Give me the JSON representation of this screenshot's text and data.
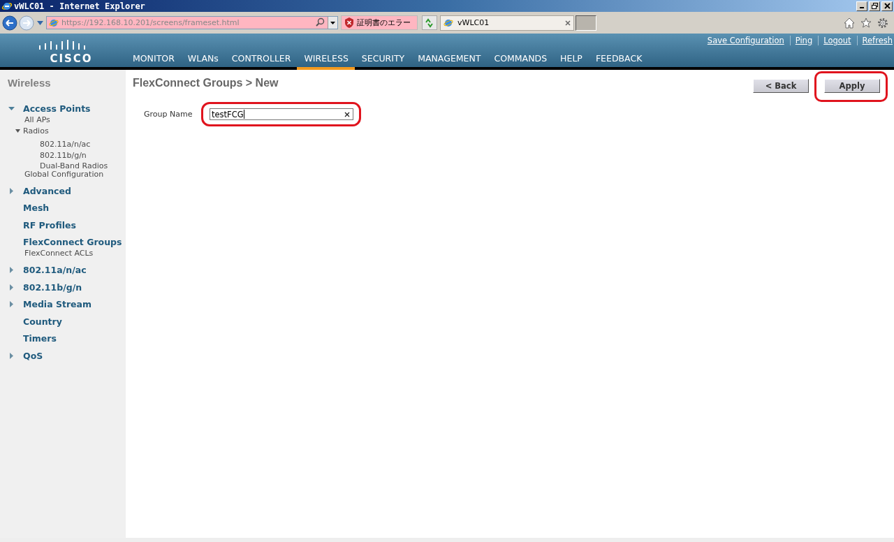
{
  "window": {
    "title": "vWLC01 - Internet Explorer"
  },
  "browser": {
    "url": "https://192.168.10.201/screens/frameset.html",
    "cert_error": "証明書のエラー",
    "tabs": [
      {
        "label": "vWLC01",
        "selected": true
      }
    ]
  },
  "header": {
    "logo": "CISCO",
    "top_links": [
      "Save Configuration",
      "Ping",
      "Logout",
      "Refresh"
    ],
    "menu": [
      {
        "label": "MONITOR",
        "selected": false
      },
      {
        "label": "WLANs",
        "selected": false
      },
      {
        "label": "CONTROLLER",
        "selected": false
      },
      {
        "label": "WIRELESS",
        "selected": true
      },
      {
        "label": "SECURITY",
        "selected": false
      },
      {
        "label": "MANAGEMENT",
        "selected": false
      },
      {
        "label": "COMMANDS",
        "selected": false
      },
      {
        "label": "HELP",
        "selected": false
      },
      {
        "label": "FEEDBACK",
        "selected": false
      }
    ]
  },
  "sidebar": {
    "title": "Wireless",
    "items": [
      {
        "label": "Access Points",
        "kind": "expandable",
        "expanded": true,
        "children": [
          {
            "label": "All APs"
          },
          {
            "label": "Radios",
            "expanded": true,
            "children": [
              {
                "label": "802.11a/n/ac"
              },
              {
                "label": "802.11b/g/n"
              },
              {
                "label": "Dual-Band Radios"
              }
            ]
          },
          {
            "label": "Global Configuration"
          }
        ]
      },
      {
        "label": "Advanced",
        "kind": "expandable",
        "expanded": false
      },
      {
        "label": "Mesh",
        "kind": "plain"
      },
      {
        "label": "RF Profiles",
        "kind": "plain"
      },
      {
        "label": "FlexConnect Groups",
        "kind": "plain",
        "children": [
          {
            "label": "FlexConnect ACLs"
          }
        ]
      },
      {
        "label": "802.11a/n/ac",
        "kind": "expandable",
        "expanded": false
      },
      {
        "label": "802.11b/g/n",
        "kind": "expandable",
        "expanded": false
      },
      {
        "label": "Media Stream",
        "kind": "expandable",
        "expanded": false
      },
      {
        "label": "Country",
        "kind": "plain"
      },
      {
        "label": "Timers",
        "kind": "plain"
      },
      {
        "label": "QoS",
        "kind": "expandable",
        "expanded": false
      }
    ]
  },
  "content": {
    "title": "FlexConnect Groups > New",
    "buttons": [
      {
        "label": "< Back",
        "annotated": false
      },
      {
        "label": "Apply",
        "annotated": true
      }
    ],
    "form": [
      {
        "label": "Group Name",
        "value": "testFCG",
        "annotated": true
      }
    ]
  }
}
